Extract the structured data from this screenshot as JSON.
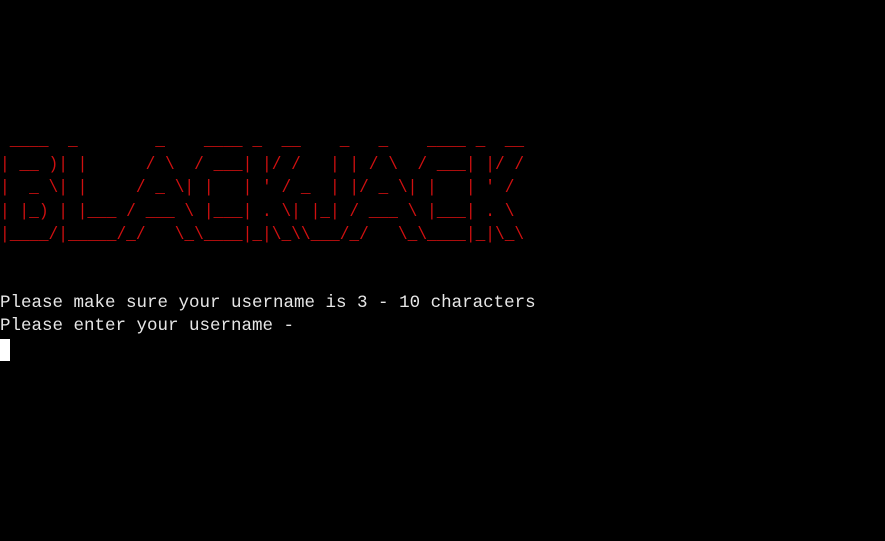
{
  "terminal": {
    "banner_art": " ____  _        _    ____ _  __    _   _    ____ _  __\n| __ )| |      / \\  / ___| |/ /   | | / \\  / ___| |/ /\n|  _ \\| |     / _ \\| |   | ' / _  | |/ _ \\| |   | ' / \n| |_) | |___ / ___ \\ |___| . \\| |_| / ___ \\ |___| . \\ \n|____/|_____/_/   \\_\\____|_|\\_\\\\___/_/   \\_\\____|_|\\_\\",
    "lines": [
      "Please make sure your username is 3 - 10 characters",
      "Please enter your username - "
    ],
    "colors": {
      "background": "#000000",
      "banner": "#d01010",
      "text": "#e6e6e6",
      "cursor": "#ffffff"
    }
  }
}
